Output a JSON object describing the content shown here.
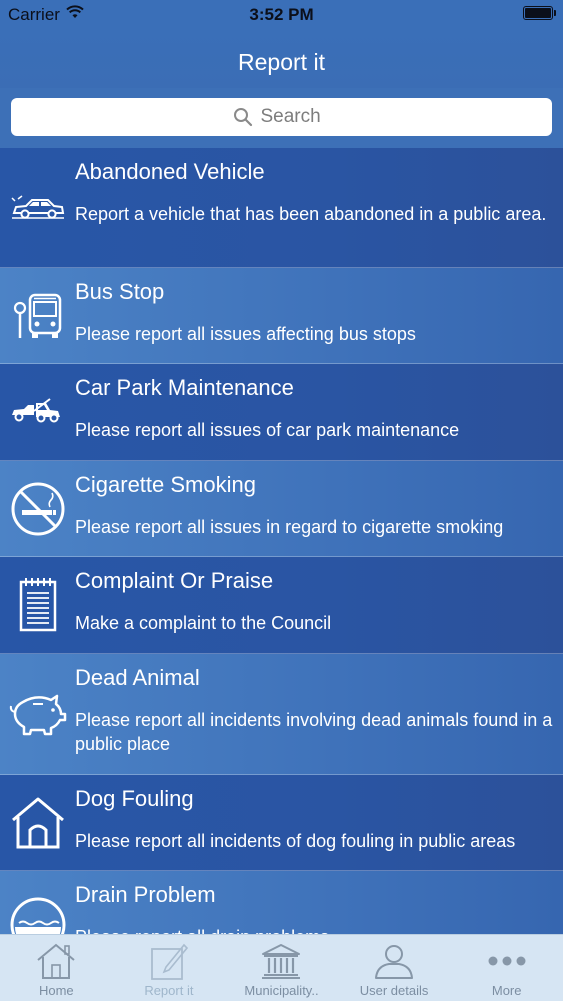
{
  "status": {
    "carrier": "Carrier",
    "time": "3:52 PM"
  },
  "nav": {
    "title": "Report it"
  },
  "search": {
    "placeholder": "Search"
  },
  "items": [
    {
      "title": "Abandoned Vehicle",
      "description": "Report a vehicle that has been abandoned in a public area.",
      "icon": "car-icon"
    },
    {
      "title": "Bus Stop",
      "description": "Please report all issues affecting bus stops",
      "icon": "bus-stop-icon"
    },
    {
      "title": "Car Park Maintenance",
      "description": "Please report all issues of car park maintenance",
      "icon": "tow-truck-icon"
    },
    {
      "title": "Cigarette Smoking",
      "description": "Please report all issues in regard to cigarette smoking",
      "icon": "no-smoking-icon"
    },
    {
      "title": "Complaint Or Praise",
      "description": "Make a complaint to the Council",
      "icon": "notepad-icon"
    },
    {
      "title": "Dead Animal",
      "description": "Please report all incidents involving dead animals found in a public place",
      "icon": "pig-icon"
    },
    {
      "title": "Dog Fouling",
      "description": "Please report all incidents of dog fouling in public areas",
      "icon": "dog-house-icon"
    },
    {
      "title": "Drain Problem",
      "description": "Please report all drain problems",
      "icon": "drain-icon"
    }
  ],
  "tabs": [
    {
      "label": "Home",
      "icon": "home-icon"
    },
    {
      "label": "Report it",
      "icon": "report-icon"
    },
    {
      "label": "Municipality..",
      "icon": "municipality-icon"
    },
    {
      "label": "User details",
      "icon": "user-icon"
    },
    {
      "label": "More",
      "icon": "more-icon"
    }
  ]
}
